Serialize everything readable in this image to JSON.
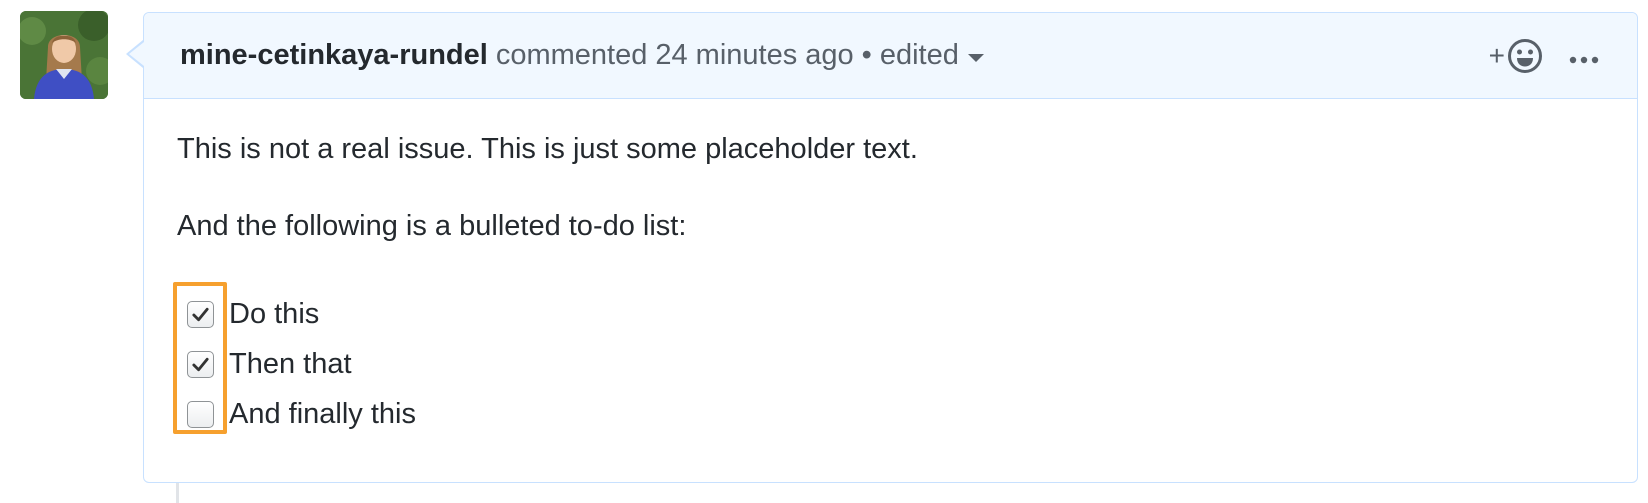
{
  "comment": {
    "author": "mine-cetinkaya-rundel",
    "action": "commented",
    "time": "24 minutes ago",
    "separator": "•",
    "edited_label": "edited",
    "reaction_plus": "+",
    "body": {
      "paragraphs": [
        "This is not a real issue. This is just some placeholder text.",
        "And the following is a bulleted to-do list:"
      ],
      "tasks": [
        {
          "label": "Do this",
          "checked": true
        },
        {
          "label": "Then that",
          "checked": true
        },
        {
          "label": "And finally this",
          "checked": false
        }
      ]
    }
  },
  "icons": {
    "reaction": "smiley-icon",
    "more": "kebab-horizontal-icon",
    "caret": "triangle-down-icon",
    "check": "check-icon"
  },
  "colors": {
    "header_bg": "#f1f8ff",
    "border": "#c8e1ff",
    "text": "#24292e",
    "muted": "#586069",
    "highlight": "#f6a02e"
  }
}
